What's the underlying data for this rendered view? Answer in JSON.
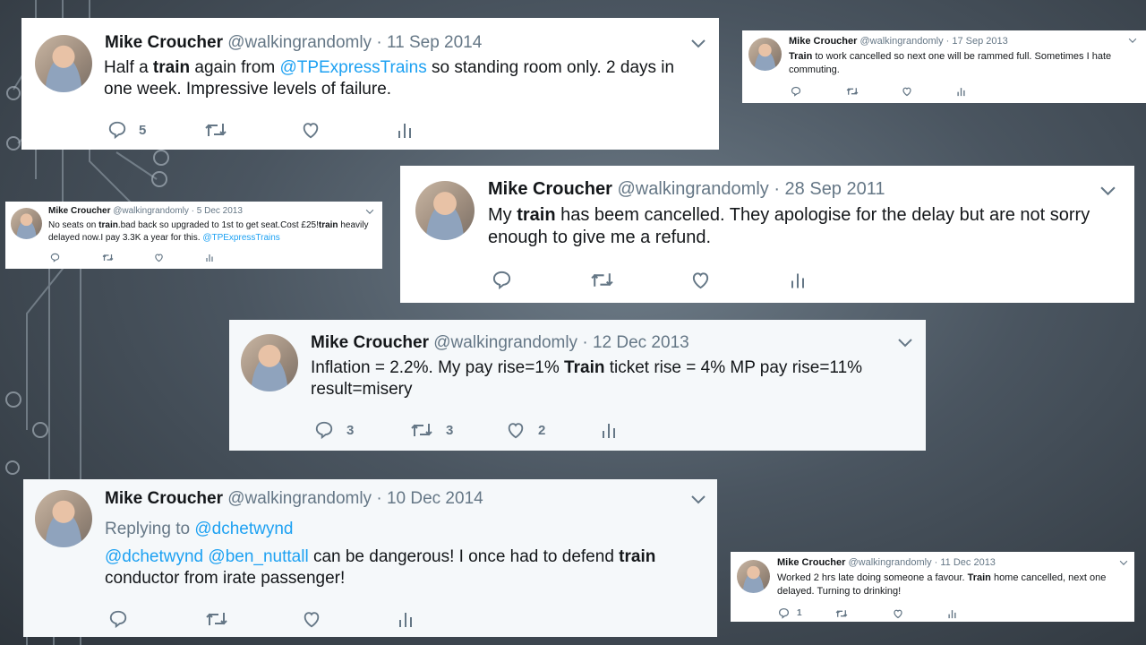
{
  "tweets": [
    {
      "name": "Mike Croucher",
      "handle": "@walkingrandomly",
      "date": "· 11 Sep 2014",
      "text_1": "Half a ",
      "bold_1": "train",
      "text_2": " again from ",
      "link_1": "@TPExpressTrains",
      "text_3": " so standing room only. 2 days in one week. Impressive levels of failure.",
      "replies": "5",
      "retweets": "",
      "likes": ""
    },
    {
      "name": "Mike Croucher",
      "handle": "@walkingrandomly",
      "date": "· 17 Sep 2013",
      "bold_1": "Train",
      "text_1": " to work cancelled so next one will be rammed full. Sometimes I hate commuting.",
      "replies": "",
      "retweets": "",
      "likes": ""
    },
    {
      "name": "Mike Croucher",
      "handle": "@walkingrandomly",
      "date": "· 5 Dec 2013",
      "text_1": "No seats on ",
      "bold_1": "train",
      "text_2": ".bad back so upgraded to 1st to get seat.Cost £25!",
      "bold_2": "train",
      "text_3": " heavily delayed now.I pay 3.3K a year for this. ",
      "link_1": "@TPExpressTrains",
      "replies": "",
      "retweets": "",
      "likes": ""
    },
    {
      "name": "Mike Croucher",
      "handle": "@walkingrandomly",
      "date": "· 28 Sep 2011",
      "text_1": "My ",
      "bold_1": "train",
      "text_2": " has beem cancelled. They apologise for the delay but are not sorry enough to give me a refund.",
      "replies": "",
      "retweets": "",
      "likes": ""
    },
    {
      "name": "Mike Croucher",
      "handle": "@walkingrandomly",
      "date": "· 12 Dec 2013",
      "text_1": "Inflation = 2.2%. My pay rise=1% ",
      "bold_1": "Train",
      "text_2": " ticket rise = 4%  MP pay rise=11% result=misery",
      "replies": "3",
      "retweets": "3",
      "likes": "2"
    },
    {
      "name": "Mike Croucher",
      "handle": "@walkingrandomly",
      "date": "· 10 Dec 2014",
      "replying_prefix": "Replying to ",
      "replying_to": "@dchetwynd",
      "link_1": "@dchetwynd",
      "link_2": "@ben_nuttall",
      "text_1": " can be dangerous! I once had to defend ",
      "bold_1": "train",
      "text_2": " conductor from irate passenger!",
      "replies": "",
      "retweets": "",
      "likes": ""
    },
    {
      "name": "Mike Croucher",
      "handle": "@walkingrandomly",
      "date": "· 11 Dec 2013",
      "text_1": "Worked 2 hrs late doing someone a favour. ",
      "bold_1": "Train",
      "text_2": " home cancelled, next one delayed. Turning to drinking!",
      "replies": "1",
      "retweets": "",
      "likes": ""
    }
  ],
  "icons": {
    "reply": "reply-icon",
    "retweet": "retweet-icon",
    "like": "heart-icon",
    "analytics": "analytics-icon",
    "menu": "chevron-down-icon"
  },
  "colors": {
    "link": "#1da1f2",
    "meta": "#657786",
    "text": "#14171a"
  }
}
